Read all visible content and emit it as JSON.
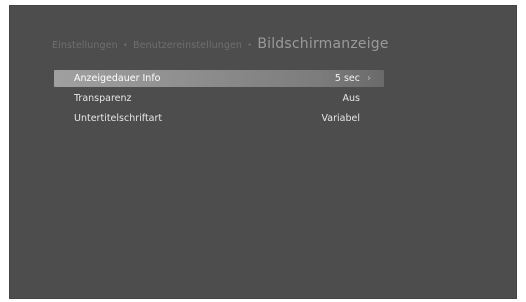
{
  "breadcrumb": {
    "items": [
      "Einstellungen",
      "Benutzereinstellungen"
    ],
    "separator": "•",
    "current": "Bildschirmanzeige"
  },
  "menu": {
    "items": [
      {
        "label": "Anzeigedauer Info",
        "value": "5 sec",
        "selected": true
      },
      {
        "label": "Transparenz",
        "value": "Aus",
        "selected": false
      },
      {
        "label": "Untertitelschriftart",
        "value": "Variabel",
        "selected": false
      }
    ]
  },
  "colors": {
    "background": "#4d4d4d",
    "selection": "#9a9a9a",
    "text": "#e6e6e6",
    "breadcrumb": "#6f6f6f"
  },
  "icons": {
    "next": "chevron-right-icon"
  }
}
